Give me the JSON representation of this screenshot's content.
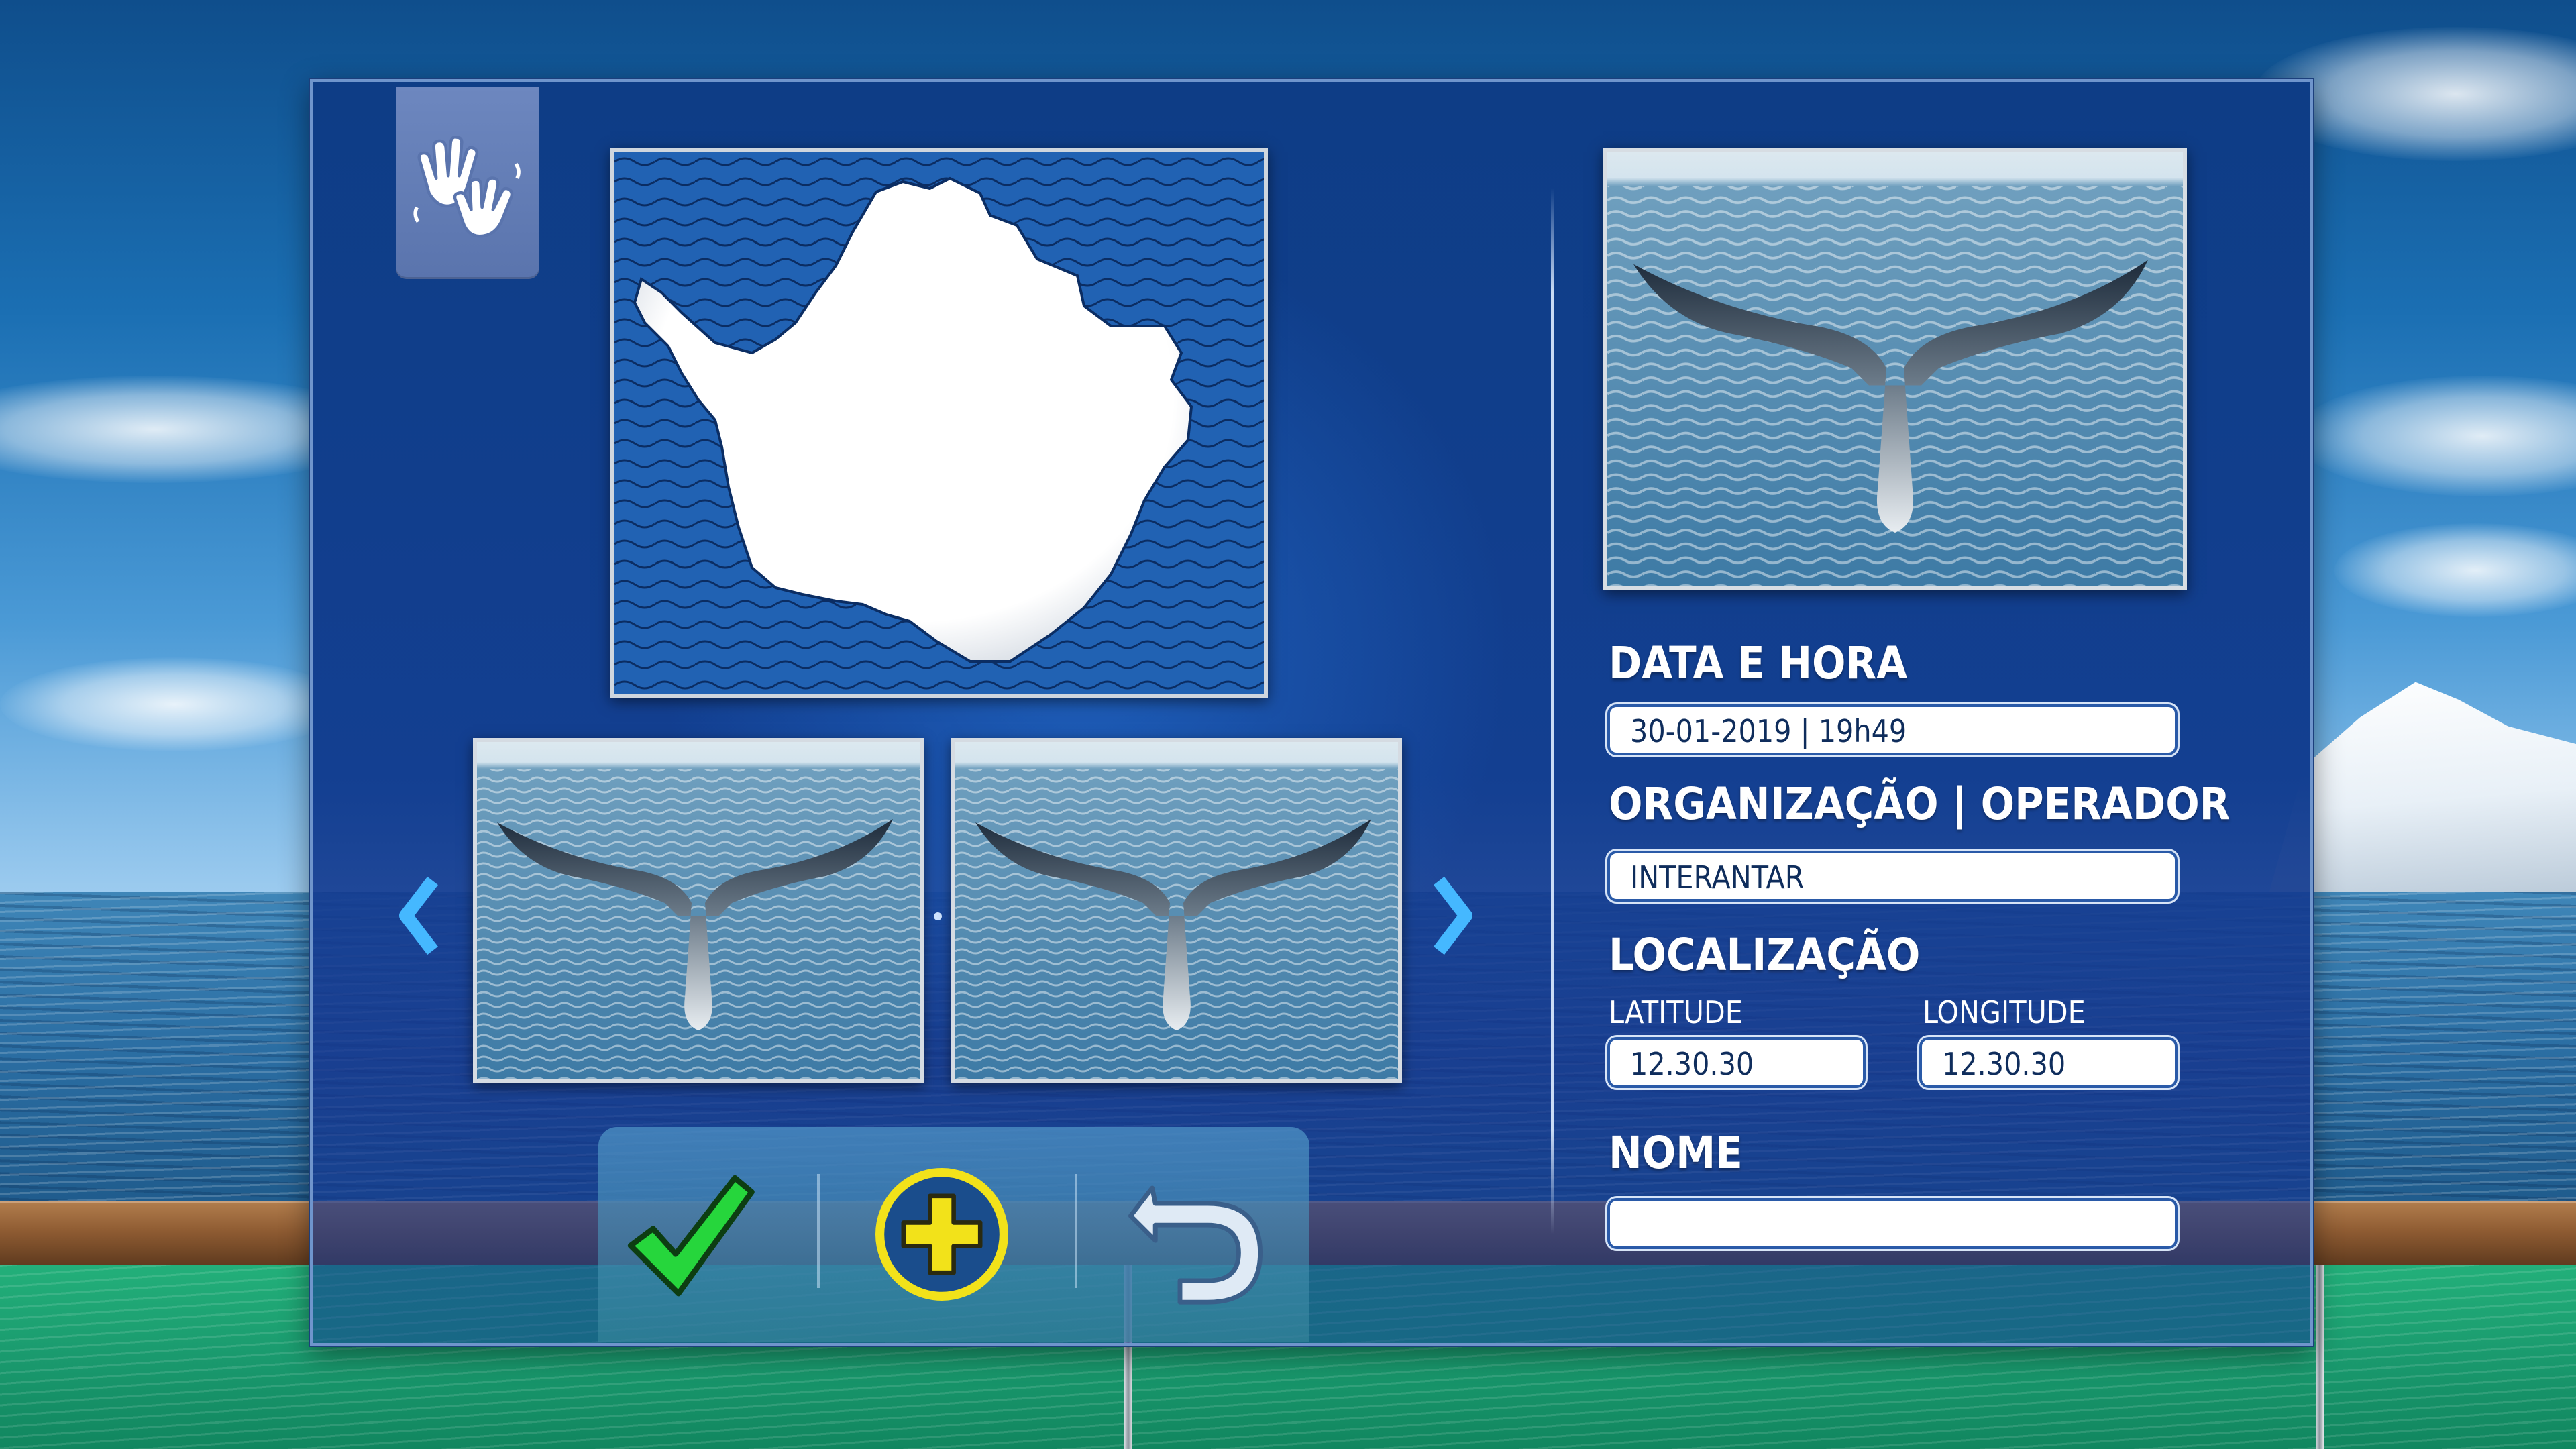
{
  "form": {
    "date_label": "DATA E HORA",
    "date_value": "30-01-2019 | 19h49",
    "org_label": "ORGANIZAÇÃO | OPERADOR",
    "org_value": "INTERANTAR",
    "location_label": "LOCALIZAÇÃO",
    "latitude_label": "LATITUDE",
    "latitude_value": "12.30.30",
    "longitude_label": "LONGITUDE",
    "longitude_value": "12.30.30",
    "name_label": "NOME",
    "name_value": ""
  },
  "carousel": {
    "prev_icon": "chevron-left-icon",
    "next_icon": "chevron-right-icon",
    "thumbnails": [
      "whale-tail-photo",
      "whale-tail-photo"
    ]
  },
  "actions": {
    "confirm_icon": "checkmark-icon",
    "add_icon": "plus-icon",
    "undo_icon": "undo-arrow-icon"
  },
  "icons": {
    "sign_language": "sign-language-hands-icon",
    "map": "antarctica-map"
  },
  "colors": {
    "panel": "#133f91",
    "accent": "#3fb2ff",
    "confirm": "#22d13a",
    "add": "#f2e21a"
  }
}
